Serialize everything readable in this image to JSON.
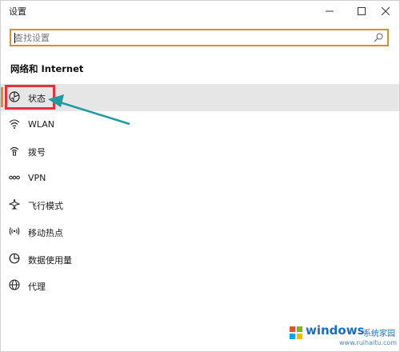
{
  "window": {
    "title": "设置"
  },
  "search": {
    "placeholder": "查找设置",
    "value": ""
  },
  "section": {
    "title": "网络和 Internet"
  },
  "nav": {
    "items": [
      {
        "label": "状态",
        "icon": "status-icon",
        "selected": true
      },
      {
        "label": "WLAN",
        "icon": "wifi-icon",
        "selected": false
      },
      {
        "label": "拨号",
        "icon": "dial-up-icon",
        "selected": false
      },
      {
        "label": "VPN",
        "icon": "vpn-icon",
        "selected": false
      },
      {
        "label": "飞行模式",
        "icon": "airplane-icon",
        "selected": false
      },
      {
        "label": "移动热点",
        "icon": "hotspot-icon",
        "selected": false
      },
      {
        "label": "数据使用量",
        "icon": "data-usage-icon",
        "selected": false
      },
      {
        "label": "代理",
        "icon": "globe-icon",
        "selected": false
      }
    ]
  },
  "colors": {
    "accent": "#e0892f",
    "highlight_box": "#e8313b",
    "annotation_arrow": "#1f9aa0",
    "selected_bg": "#e6e6e6"
  },
  "watermark": {
    "brand": "windows",
    "cn": "系统家园",
    "url": "www.ruihaitu.com"
  }
}
